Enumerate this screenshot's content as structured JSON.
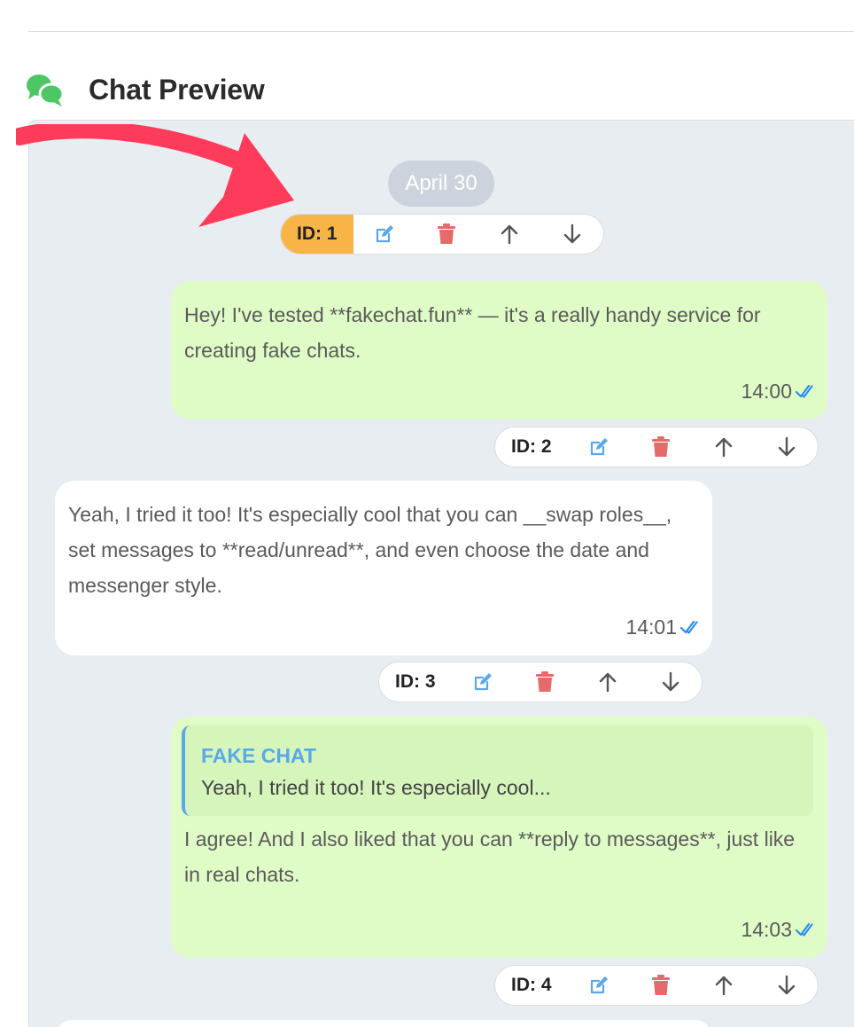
{
  "header": {
    "title": "Chat Preview",
    "icon": "chat-bubbles-icon",
    "icon_color": "#4cc764"
  },
  "chat": {
    "date_label": "April 30",
    "messages": [
      {
        "id_label": "ID: 1",
        "direction": "out",
        "text": "Hey! I've tested **fakechat.fun** — it's a really handy service for creating fake chats.",
        "time": "14:00",
        "status": "read"
      },
      {
        "id_label": "ID: 2",
        "direction": "in",
        "text": "Yeah, I tried it too! It's especially cool that you can __swap roles__, set messages to **read/unread**, and even choose the date and messenger style.",
        "time": "14:01",
        "status": "read"
      },
      {
        "id_label": "ID: 3",
        "direction": "out",
        "reply_to": {
          "name": "FAKE CHAT",
          "text": "Yeah, I tried it too! It's especially cool..."
        },
        "text": "I agree! And I also liked that you can **reply to messages**, just like in real chats.",
        "time": "14:03",
        "status": "read"
      },
      {
        "id_label": "ID: 4",
        "direction": "in",
        "text": ""
      }
    ]
  },
  "toolbar_icons": [
    "edit-icon",
    "delete-icon",
    "move-up-icon",
    "move-down-icon"
  ],
  "colors": {
    "outgoing_bubble": "#e0fcc6",
    "incoming_bubble": "#ffffff",
    "active_id_badge": "#f9b447",
    "edit": "#5aa8e6",
    "delete": "#e56b6b",
    "read_check": "#2b8ef0",
    "annotation_arrow": "#ff3b5c"
  }
}
